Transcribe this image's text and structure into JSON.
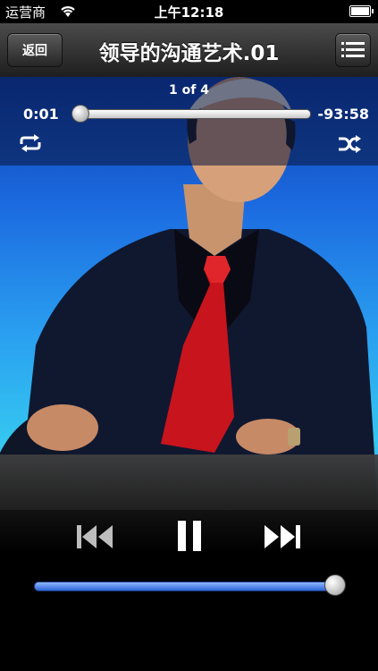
{
  "status_bar": {
    "carrier": "运营商",
    "time": "上午12:18"
  },
  "nav": {
    "back_label": "返回",
    "title": "领导的沟通艺术.01"
  },
  "player": {
    "track_count": "1 of 4",
    "elapsed": "0:01",
    "remaining": "-93:58",
    "progress_fraction": 0.0002,
    "volume_fraction": 0.97
  },
  "colors": {
    "scrubber_fill": "#ffffff",
    "volume_fill": "#2d66d8",
    "artwork_background": "#1c6be0"
  },
  "icons": {
    "wifi": "wifi-icon",
    "battery": "battery-icon",
    "menu": "list-icon",
    "repeat": "repeat-icon",
    "shuffle": "shuffle-icon",
    "previous": "previous-track-icon",
    "pause": "pause-icon",
    "next": "next-track-icon"
  }
}
